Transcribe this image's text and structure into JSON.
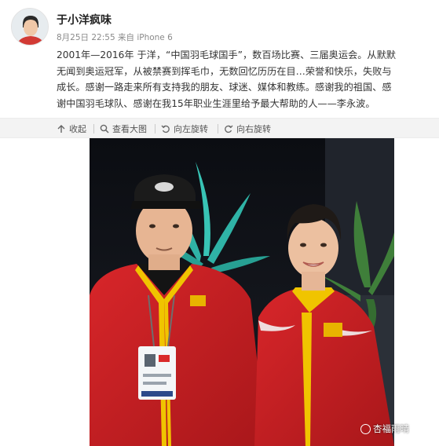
{
  "post": {
    "username": "于小洋疯味",
    "date": "8月25日 22:55",
    "source_prefix": "来自",
    "source": "iPhone 6",
    "body_lines": [
      "2001年—2016年 于洋，“中国羽毛球国手”，数百场比赛、三届奥运会。从默默",
      "无闻到奥运冠军，从被禁赛到挥毛巾，无数回忆历历在目…荣誉和快乐，失败与",
      "成长。感谢一路走来所有支持我的朋友、球迷、媒体和教练。感谢我的祖国、感",
      "谢中国羽毛球队、感谢在我15年职业生涯里给予最大帮助的人——李永波。"
    ]
  },
  "toolbar": {
    "collapse": "收起",
    "view_large": "查看大图",
    "rotate_left": "向左旋转",
    "rotate_right": "向右旋转"
  },
  "watermark": {
    "text": "杏福雨晴"
  },
  "colors": {
    "jacket_red": "#c8201f",
    "accent_yellow": "#f2c200",
    "toolbar_bg": "#f3f3f3",
    "meta_gray": "#8a8a8a"
  },
  "icons": [
    "collapse-arrow-icon",
    "search-icon",
    "rotate-left-icon",
    "rotate-right-icon",
    "watermark-icon"
  ]
}
